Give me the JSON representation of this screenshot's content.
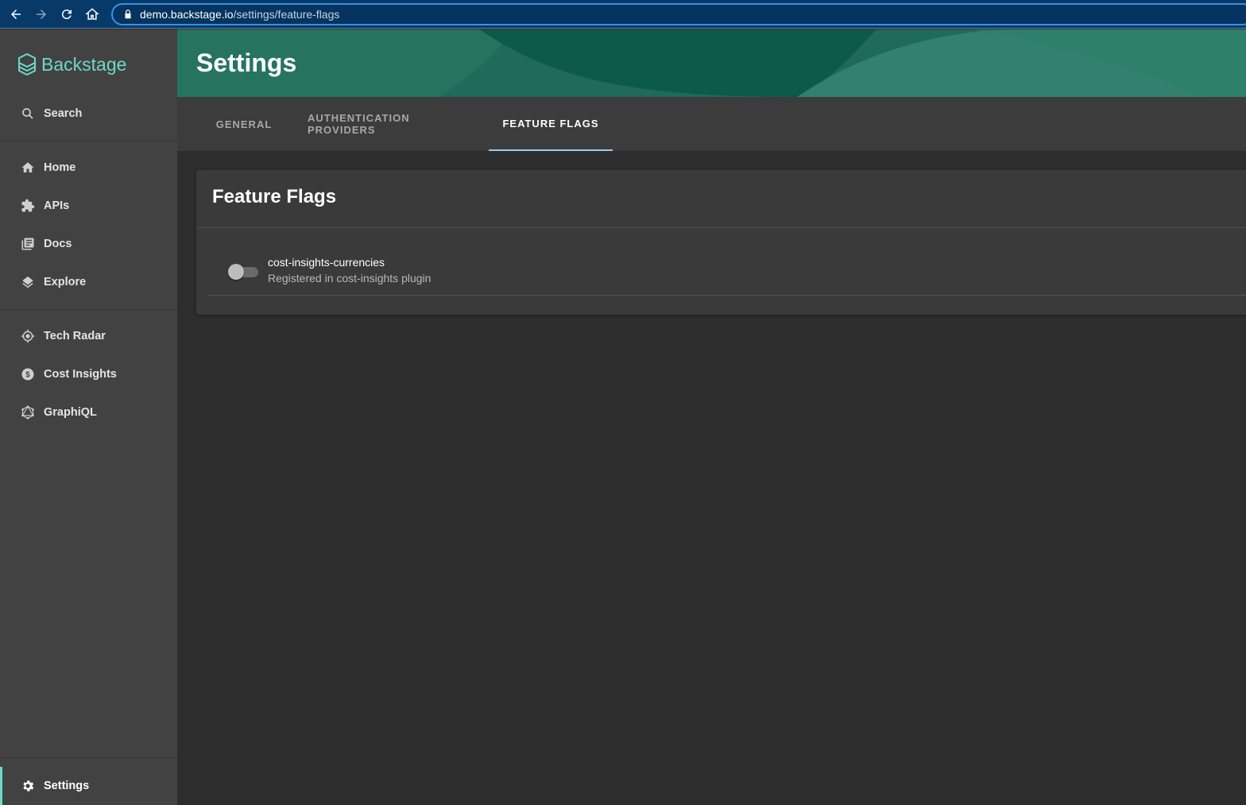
{
  "browser": {
    "url_host": "demo.backstage.io",
    "url_path": "/settings/feature-flags"
  },
  "sidebar": {
    "logo_text": "Backstage",
    "search_label": "Search",
    "items": [
      {
        "label": "Home",
        "icon": "home-icon"
      },
      {
        "label": "APIs",
        "icon": "puzzle-icon"
      },
      {
        "label": "Docs",
        "icon": "library-books-icon"
      },
      {
        "label": "Explore",
        "icon": "layers-icon"
      }
    ],
    "plugin_items": [
      {
        "label": "Tech Radar",
        "icon": "radar-icon"
      },
      {
        "label": "Cost Insights",
        "icon": "money-icon"
      },
      {
        "label": "GraphiQL",
        "icon": "graphql-icon"
      }
    ],
    "settings_label": "Settings"
  },
  "header": {
    "title": "Settings"
  },
  "tabs": [
    {
      "label": "GENERAL",
      "active": false
    },
    {
      "label": "AUTHENTICATION PROVIDERS",
      "active": false
    },
    {
      "label": "FEATURE FLAGS",
      "active": true
    }
  ],
  "feature_flags": {
    "title": "Feature Flags",
    "flags": [
      {
        "name": "cost-insights-currencies",
        "description": "Registered in cost-insights plugin",
        "enabled": false
      }
    ]
  },
  "colors": {
    "accent": "#6ed8c9",
    "header": "#1f6a5b",
    "tab_indicator": "#9bc9f0"
  }
}
